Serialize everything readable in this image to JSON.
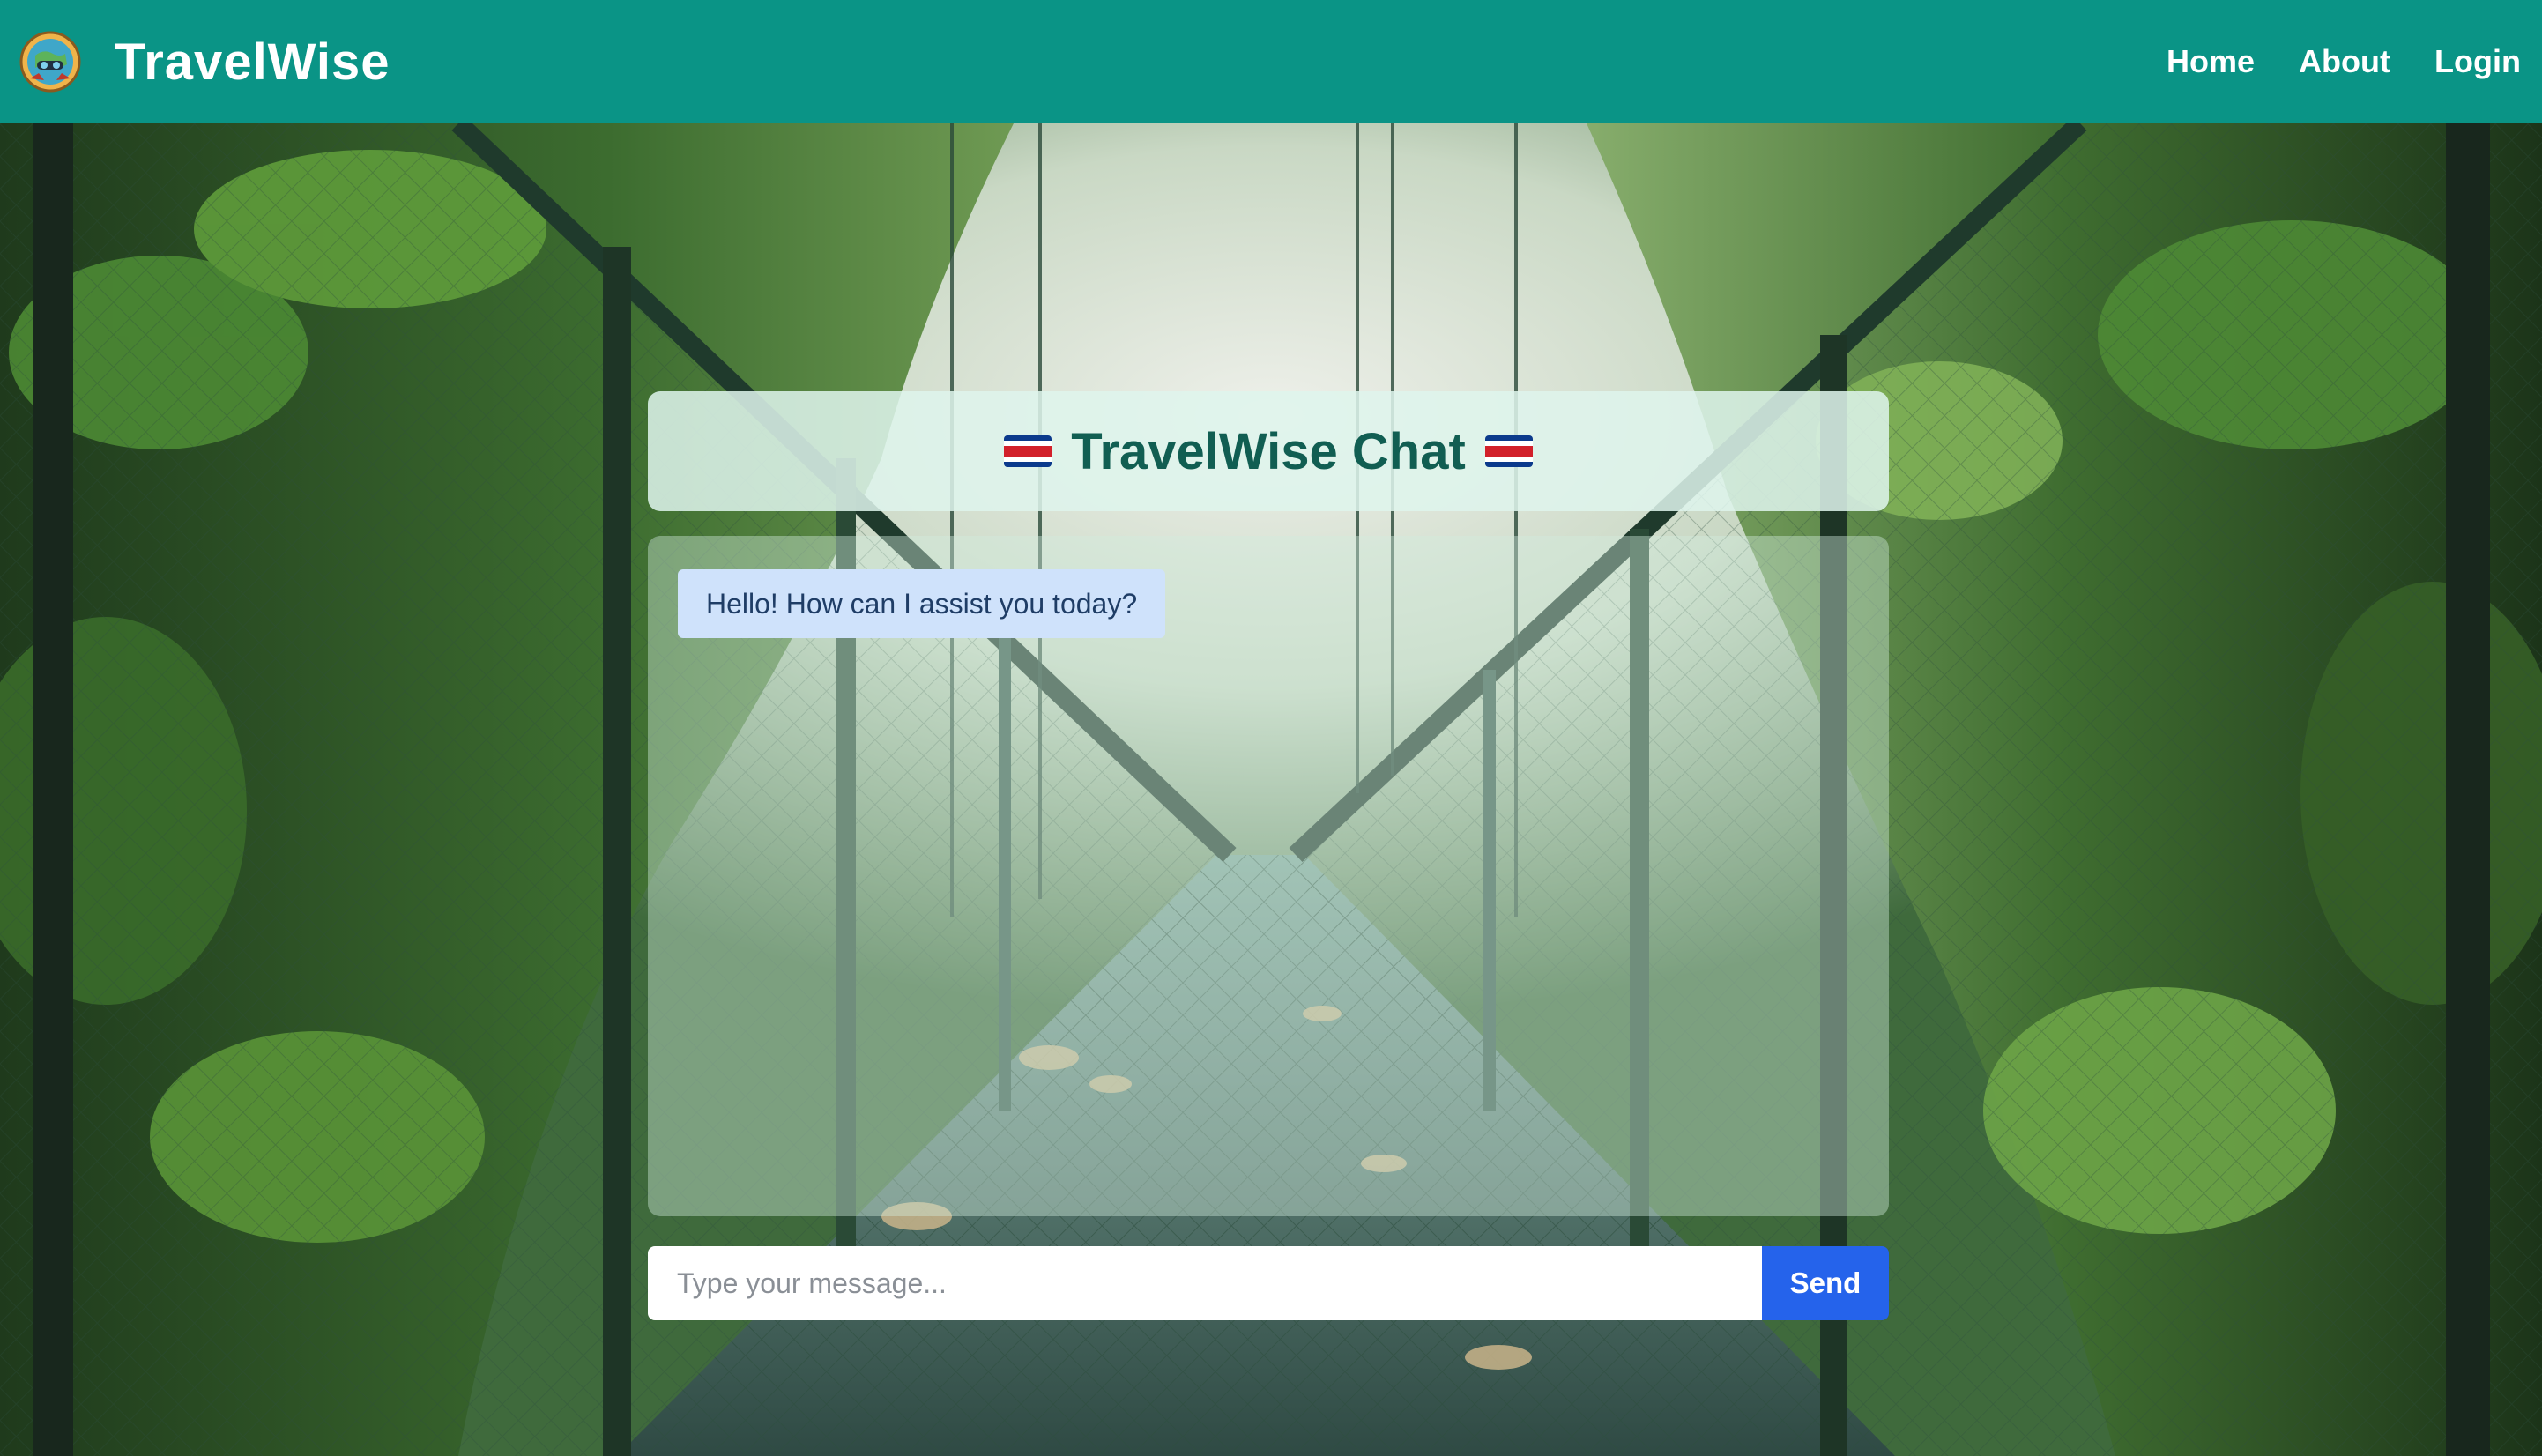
{
  "header": {
    "brand": "TravelWise",
    "logo_icon": "travel-globe-logo-icon",
    "nav": [
      {
        "label": "Home"
      },
      {
        "label": "About"
      },
      {
        "label": "Login"
      }
    ],
    "background_color": "#0a9486"
  },
  "background": {
    "image": "suspension bridge in rainforest"
  },
  "chat": {
    "title": "TravelWise Chat",
    "title_icon": "costa-rica-flag-icon",
    "title_color": "#115e52",
    "messages": [
      {
        "sender": "bot",
        "text": "Hello! How can I assist you today?"
      }
    ],
    "input": {
      "placeholder": "Type your message...",
      "value": ""
    },
    "send_label": "Send",
    "send_color": "#2563eb"
  }
}
